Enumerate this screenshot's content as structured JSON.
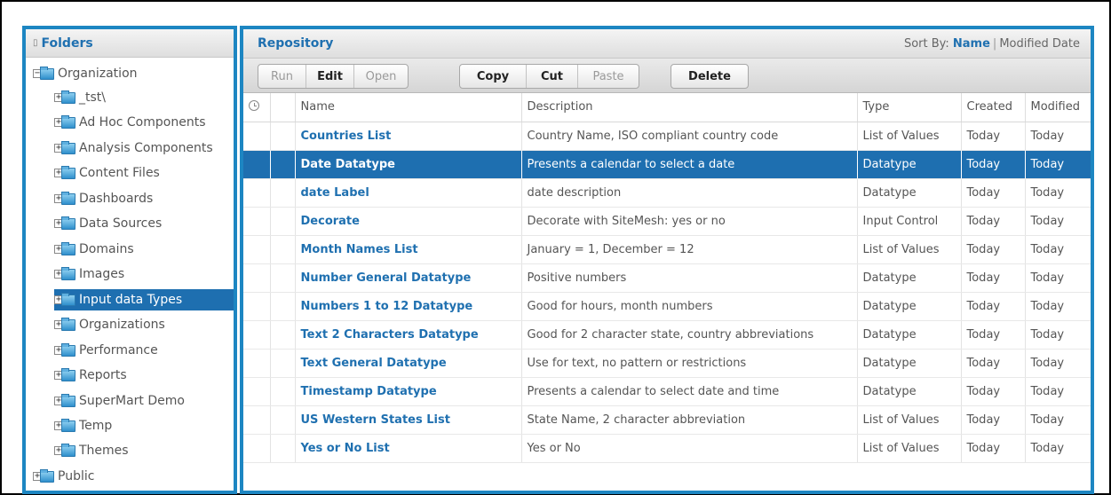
{
  "folders": {
    "title": "Folders",
    "tree": [
      {
        "label": "Organization",
        "expander": "−"
      },
      {
        "label": "_tst\\",
        "expander": "+"
      },
      {
        "label": "Ad Hoc Components",
        "expander": "+"
      },
      {
        "label": "Analysis Components",
        "expander": "+"
      },
      {
        "label": "Content Files",
        "expander": "+"
      },
      {
        "label": "Dashboards",
        "expander": "+"
      },
      {
        "label": "Data Sources",
        "expander": "+"
      },
      {
        "label": "Domains",
        "expander": "+"
      },
      {
        "label": "Images",
        "expander": "+"
      },
      {
        "label": "Input data Types",
        "expander": "+",
        "selected": true
      },
      {
        "label": "Organizations",
        "expander": "+"
      },
      {
        "label": "Performance",
        "expander": "+"
      },
      {
        "label": "Reports",
        "expander": "+"
      },
      {
        "label": "SuperMart Demo",
        "expander": "+"
      },
      {
        "label": "Temp",
        "expander": "+"
      },
      {
        "label": "Themes",
        "expander": "+"
      },
      {
        "label": "Public",
        "expander": "+"
      }
    ]
  },
  "repository": {
    "title": "Repository",
    "sort": {
      "label": "Sort By:",
      "active": "Name",
      "other": "Modified Date"
    },
    "toolbar": {
      "run": "Run",
      "edit": "Edit",
      "open": "Open",
      "copy": "Copy",
      "cut": "Cut",
      "paste": "Paste",
      "delete": "Delete"
    },
    "columns": {
      "name": "Name",
      "description": "Description",
      "type": "Type",
      "created": "Created",
      "modified": "Modified"
    },
    "rows": [
      {
        "name": "Countries List",
        "description": "Country Name, ISO compliant country code",
        "type": "List of Values",
        "created": "Today",
        "modified": "Today"
      },
      {
        "name": "Date Datatype",
        "description": "Presents a calendar to select a date",
        "type": "Datatype",
        "created": "Today",
        "modified": "Today",
        "selected": true
      },
      {
        "name": "date Label",
        "description": "date description",
        "type": "Datatype",
        "created": "Today",
        "modified": "Today"
      },
      {
        "name": "Decorate",
        "description": "Decorate with SiteMesh: yes or no",
        "type": "Input Control",
        "created": "Today",
        "modified": "Today"
      },
      {
        "name": "Month Names List",
        "description": "January = 1, December = 12",
        "type": "List of Values",
        "created": "Today",
        "modified": "Today"
      },
      {
        "name": "Number General Datatype",
        "description": "Positive numbers",
        "type": "Datatype",
        "created": "Today",
        "modified": "Today"
      },
      {
        "name": "Numbers 1 to 12 Datatype",
        "description": "Good for hours, month numbers",
        "type": "Datatype",
        "created": "Today",
        "modified": "Today"
      },
      {
        "name": "Text 2 Characters Datatype",
        "description": "Good for 2 character state, country abbreviations",
        "type": "Datatype",
        "created": "Today",
        "modified": "Today"
      },
      {
        "name": "Text General Datatype",
        "description": "Use for text, no pattern or restrictions",
        "type": "Datatype",
        "created": "Today",
        "modified": "Today"
      },
      {
        "name": "Timestamp Datatype",
        "description": "Presents a calendar to select date and time",
        "type": "Datatype",
        "created": "Today",
        "modified": "Today"
      },
      {
        "name": "US Western States List",
        "description": "State Name, 2 character abbreviation",
        "type": "List of Values",
        "created": "Today",
        "modified": "Today"
      },
      {
        "name": "Yes or No List",
        "description": "Yes or No",
        "type": "List of Values",
        "created": "Today",
        "modified": "Today"
      }
    ]
  },
  "colors": {
    "accent": "#1e6fb0",
    "border": "#1d86c2",
    "link": "#1f70b0"
  },
  "icons": {
    "folder": "folder-icon",
    "expander": "expand-toggle-icon",
    "schedule": "clock-icon"
  }
}
